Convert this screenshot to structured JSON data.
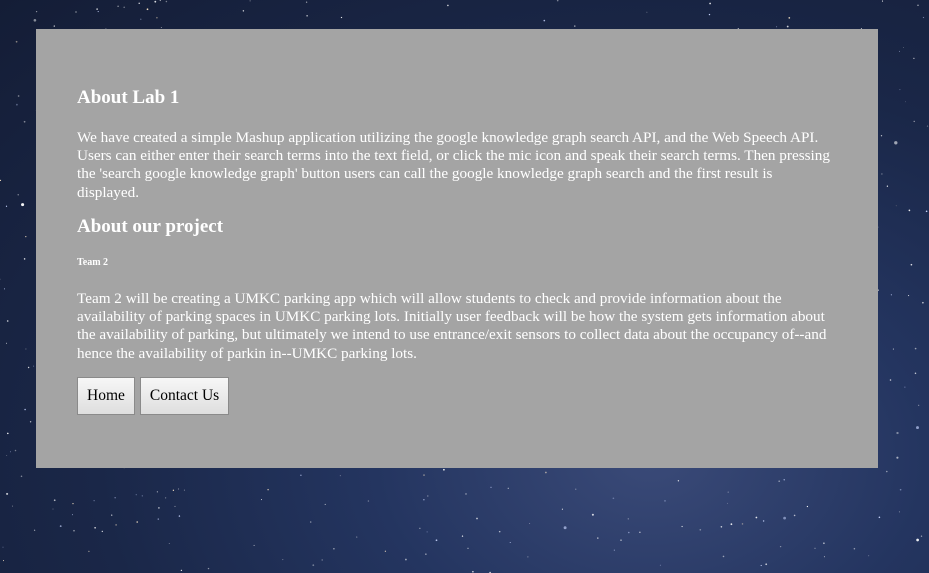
{
  "about_lab": {
    "heading": "About Lab 1",
    "text": "We have created a simple Mashup application utilizing the google knowledge graph search API, and the Web Speech API. Users can either enter their search terms into the text field, or click the mic icon and speak their search terms. Then pressing the 'search google knowledge graph' button users can call the google knowledge graph search and the first result is displayed."
  },
  "about_project": {
    "heading": "About our project",
    "team": "Team 2",
    "text": "Team 2 will be creating a UMKC parking app which will allow students to check and provide information about the availability of parking spaces in UMKC parking lots. Initially user feedback will be how the system gets information about the availability of parking, but ultimately we intend to use entrance/exit sensors to collect data about the occupancy of--and hence the availability of parkin in--UMKC parking lots."
  },
  "buttons": {
    "home": "Home",
    "contact": "Contact Us"
  },
  "colors": {
    "panel": "#a4a4a4",
    "text": "#ffffff"
  }
}
